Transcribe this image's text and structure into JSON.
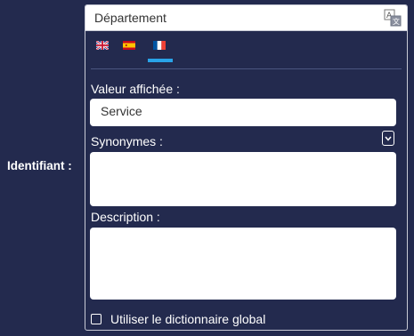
{
  "field": {
    "label": "Identifiant :"
  },
  "panel": {
    "title": "Département",
    "translate_icon": "translate-icon",
    "languages": [
      {
        "code": "en",
        "flag": "uk-flag-icon"
      },
      {
        "code": "es",
        "flag": "spain-flag-icon"
      },
      {
        "code": "fr",
        "flag": "france-flag-icon",
        "selected": true
      }
    ],
    "display_value": {
      "label": "Valeur affichée :",
      "value": "Service"
    },
    "synonyms": {
      "label": "Synonymes :",
      "value": ""
    },
    "description": {
      "label": "Description :",
      "value": ""
    },
    "global_dictionary": {
      "label": "Utiliser le dictionnaire global",
      "checked": false
    }
  },
  "colors": {
    "background": "#232a4e",
    "accent": "#29a3e8",
    "border": "#c9cbd6"
  }
}
